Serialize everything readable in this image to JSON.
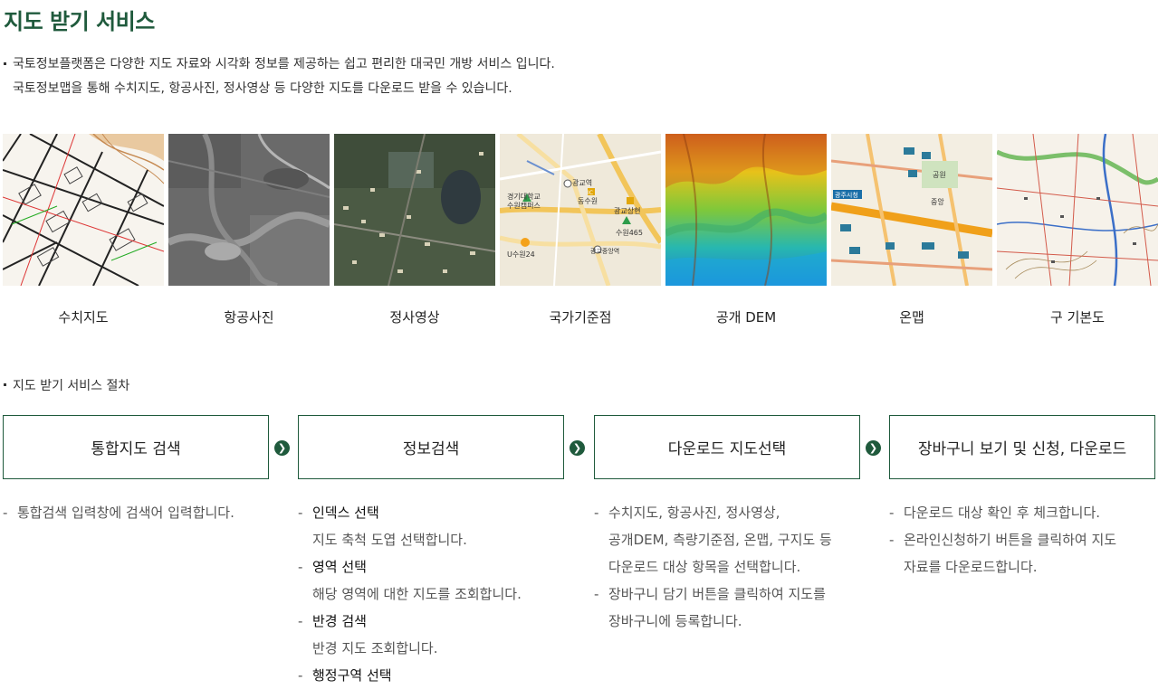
{
  "page_title": "지도 받기 서비스",
  "intro": [
    "국토정보플랫폼은 다양한 지도 자료와 시각화 정보를 제공하는 쉽고 편리한 대국민 개방 서비스 입니다.",
    "국토정보맵을 통해 수치지도, 항공사진, 정사영상 등 다양한 지도를 다운로드 받을 수 있습니다."
  ],
  "maps": [
    {
      "label": "수치지도",
      "icon": "digital-map-thumbnail"
    },
    {
      "label": "항공사진",
      "icon": "aerial-photo-thumbnail"
    },
    {
      "label": "정사영상",
      "icon": "orthophoto-thumbnail"
    },
    {
      "label": "국가기준점",
      "icon": "control-point-thumbnail"
    },
    {
      "label": "공개 DEM",
      "icon": "dem-thumbnail"
    },
    {
      "label": "온맵",
      "icon": "onmap-thumbnail"
    },
    {
      "label": "구 기본도",
      "icon": "old-basemap-thumbnail"
    }
  ],
  "control_point_map_text": [
    "경기대학교",
    "수원캠퍼스",
    "광교역",
    "동수원",
    "IC",
    "광교상현",
    "수원465",
    "U수원24",
    "광교중앙역"
  ],
  "onmap_text": [
    "광주시청",
    "중앙",
    "공원"
  ],
  "process_title": "지도 받기 서비스 절차",
  "steps": [
    {
      "label": "통합지도 검색"
    },
    {
      "label": "정보검색"
    },
    {
      "label": "다운로드 지도선택"
    },
    {
      "label": "장바구니 보기 및 신청, 다운로드"
    }
  ],
  "descriptions": {
    "step1": [
      "통합검색 입력창에 검색어 입력합니다."
    ],
    "step2": [
      {
        "title": "인덱스 선택",
        "text": "지도 축척 도엽 선택합니다."
      },
      {
        "title": "영역 선택",
        "text": "해당 영역에 대한 지도를 조회합니다."
      },
      {
        "title": "반경 검색",
        "text": "반경 지도 조회합니다."
      },
      {
        "title": "행정구역 선택",
        "text": ""
      }
    ],
    "step3": [
      [
        "수치지도, 항공사진, 정사영상,",
        "공개DEM, 측량기준점, 온맵, 구지도 등",
        "다운로드 대상 항목을 선택합니다."
      ],
      [
        "장바구니 담기 버튼을 클릭하여 지도를",
        "장바구니에 등록합니다."
      ]
    ],
    "step4": [
      [
        "다운로드 대상 확인 후 체크합니다."
      ],
      [
        "온라인신청하기 버튼을 클릭하여 지도",
        "자료를 다운로드합니다."
      ]
    ]
  },
  "colors": {
    "accent": "#1f5a3c",
    "text": "#333333"
  }
}
